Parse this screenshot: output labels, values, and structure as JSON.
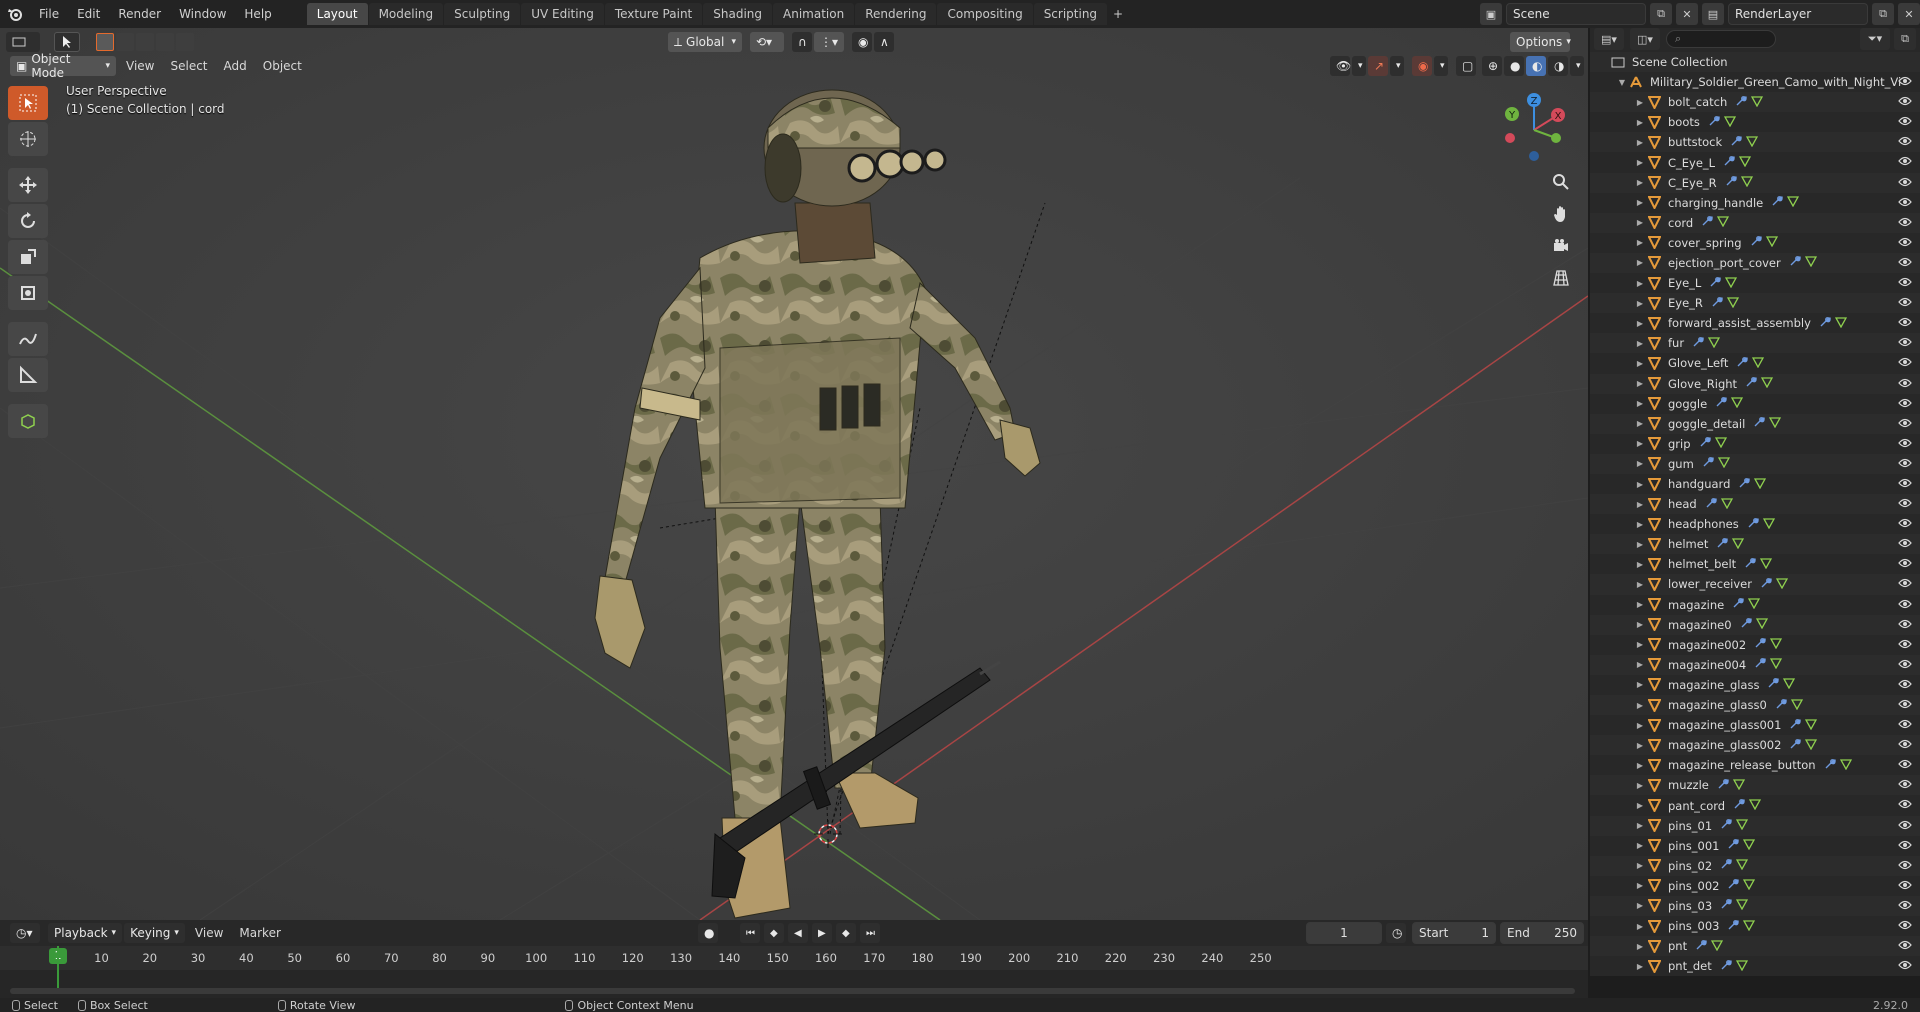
{
  "menubar": {
    "items": [
      "File",
      "Edit",
      "Render",
      "Window",
      "Help"
    ],
    "workspaces": [
      "Layout",
      "Modeling",
      "Sculpting",
      "UV Editing",
      "Texture Paint",
      "Shading",
      "Animation",
      "Rendering",
      "Compositing",
      "Scripting"
    ],
    "active_workspace": "Layout",
    "scene": "Scene",
    "render_layer": "RenderLayer"
  },
  "viewport": {
    "mode": "Object Mode",
    "menus": [
      "View",
      "Select",
      "Add",
      "Object"
    ],
    "orientation": "Global",
    "options_label": "Options",
    "perspective_label": "User Perspective",
    "collection_label": "(1) Scene Collection | cord",
    "gizmo_axes": [
      "X",
      "Y",
      "Z"
    ]
  },
  "outliner": {
    "root": "Scene Collection",
    "collection": "Military_Soldier_Green_Camo_with_Night_Vi",
    "objects": [
      "bolt_catch",
      "boots",
      "buttstock",
      "C_Eye_L",
      "C_Eye_R",
      "charging_handle",
      "cord",
      "cover_spring",
      "ejection_port_cover",
      "Eye_L",
      "Eye_R",
      "forward_assist_assembly",
      "fur",
      "Glove_Left",
      "Glove_Right",
      "goggle",
      "goggle_detail",
      "grip",
      "gum",
      "handguard",
      "head",
      "headphones",
      "helmet",
      "helmet_belt",
      "lower_receiver",
      "magazine",
      "magazine0",
      "magazine002",
      "magazine004",
      "magazine_glass",
      "magazine_glass0",
      "magazine_glass001",
      "magazine_glass002",
      "magazine_release_button",
      "muzzle",
      "pant_cord",
      "pins_01",
      "pins_001",
      "pins_02",
      "pins_002",
      "pins_03",
      "pins_003",
      "pnt",
      "pnt_det"
    ],
    "selected": "cord",
    "search_placeholder": ""
  },
  "timeline": {
    "menus": [
      "Playback",
      "Keying",
      "View",
      "Marker"
    ],
    "current_frame": "1",
    "start_label": "Start",
    "start": "1",
    "end_label": "End",
    "end": "250",
    "ticks": [
      "10",
      "20",
      "30",
      "40",
      "50",
      "60",
      "70",
      "80",
      "90",
      "100",
      "110",
      "120",
      "130",
      "140",
      "150",
      "160",
      "170",
      "180",
      "190",
      "200",
      "210",
      "220",
      "230",
      "240",
      "250"
    ],
    "marker": "1"
  },
  "statusbar": {
    "select": "Select",
    "box_select": "Box Select",
    "rotate": "Rotate View",
    "context_menu": "Object Context Menu",
    "version": "2.92.0"
  },
  "colors": {
    "accent": "#4772b3",
    "selected_bg": "#334d80",
    "object_orange": "#e59a3a",
    "axis_x": "#d44a5a",
    "axis_y": "#6fb43f",
    "axis_z": "#3d8fe0",
    "frame_green": "#3a9a3a"
  }
}
